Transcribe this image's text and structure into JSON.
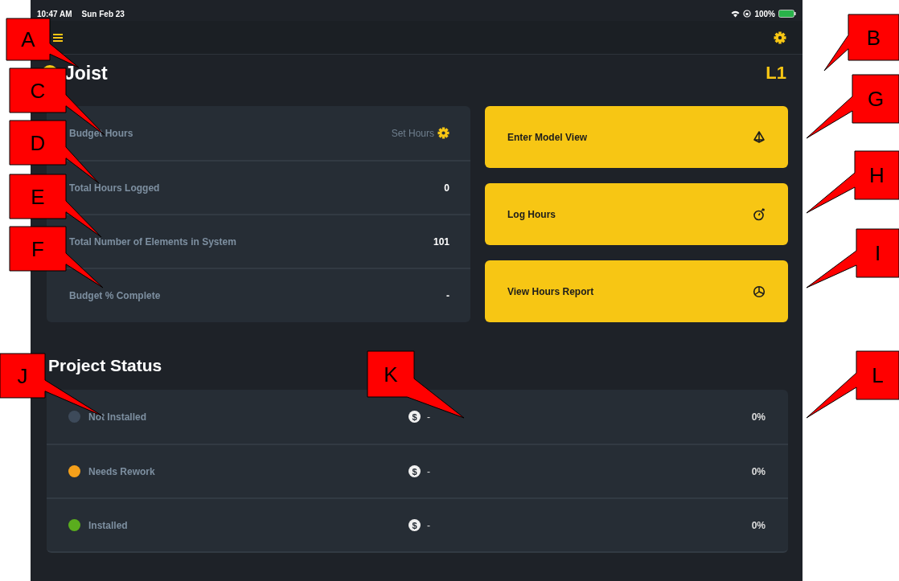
{
  "status_bar": {
    "time": "10:47 AM",
    "date": "Sun Feb 23",
    "battery": "100%"
  },
  "header": {
    "title": "Joist",
    "level": "L1"
  },
  "budget_rows": [
    {
      "label": "Budget Hours",
      "kind": "action",
      "value": "Set Hours"
    },
    {
      "label": "Total Hours Logged",
      "kind": "value",
      "value": "0"
    },
    {
      "label": "Total Number of Elements in System",
      "kind": "value",
      "value": "101"
    },
    {
      "label": "Budget % Complete",
      "kind": "value",
      "value": "-"
    }
  ],
  "actions": [
    {
      "label": "Enter Model View",
      "kind": "model"
    },
    {
      "label": "Log Hours",
      "kind": "timer"
    },
    {
      "label": "View Hours Report",
      "kind": "report"
    }
  ],
  "project_status": {
    "title": "Project Status",
    "rows": [
      {
        "label": "Not Installed",
        "color": "#3d4a5a",
        "cost_symbol": "$",
        "cost": "-",
        "percent": "0%"
      },
      {
        "label": "Needs Rework",
        "color": "#f5a01a",
        "cost_symbol": "$",
        "cost": "-",
        "percent": "0%"
      },
      {
        "label": "Installed",
        "color": "#5aad1e",
        "cost_symbol": "$",
        "cost": "-",
        "percent": "0%"
      }
    ]
  },
  "callouts": [
    {
      "label": "A"
    },
    {
      "label": "B"
    },
    {
      "label": "C"
    },
    {
      "label": "D"
    },
    {
      "label": "E"
    },
    {
      "label": "F"
    },
    {
      "label": "G"
    },
    {
      "label": "H"
    },
    {
      "label": "I"
    },
    {
      "label": "J"
    },
    {
      "label": "K"
    },
    {
      "label": "L"
    }
  ]
}
